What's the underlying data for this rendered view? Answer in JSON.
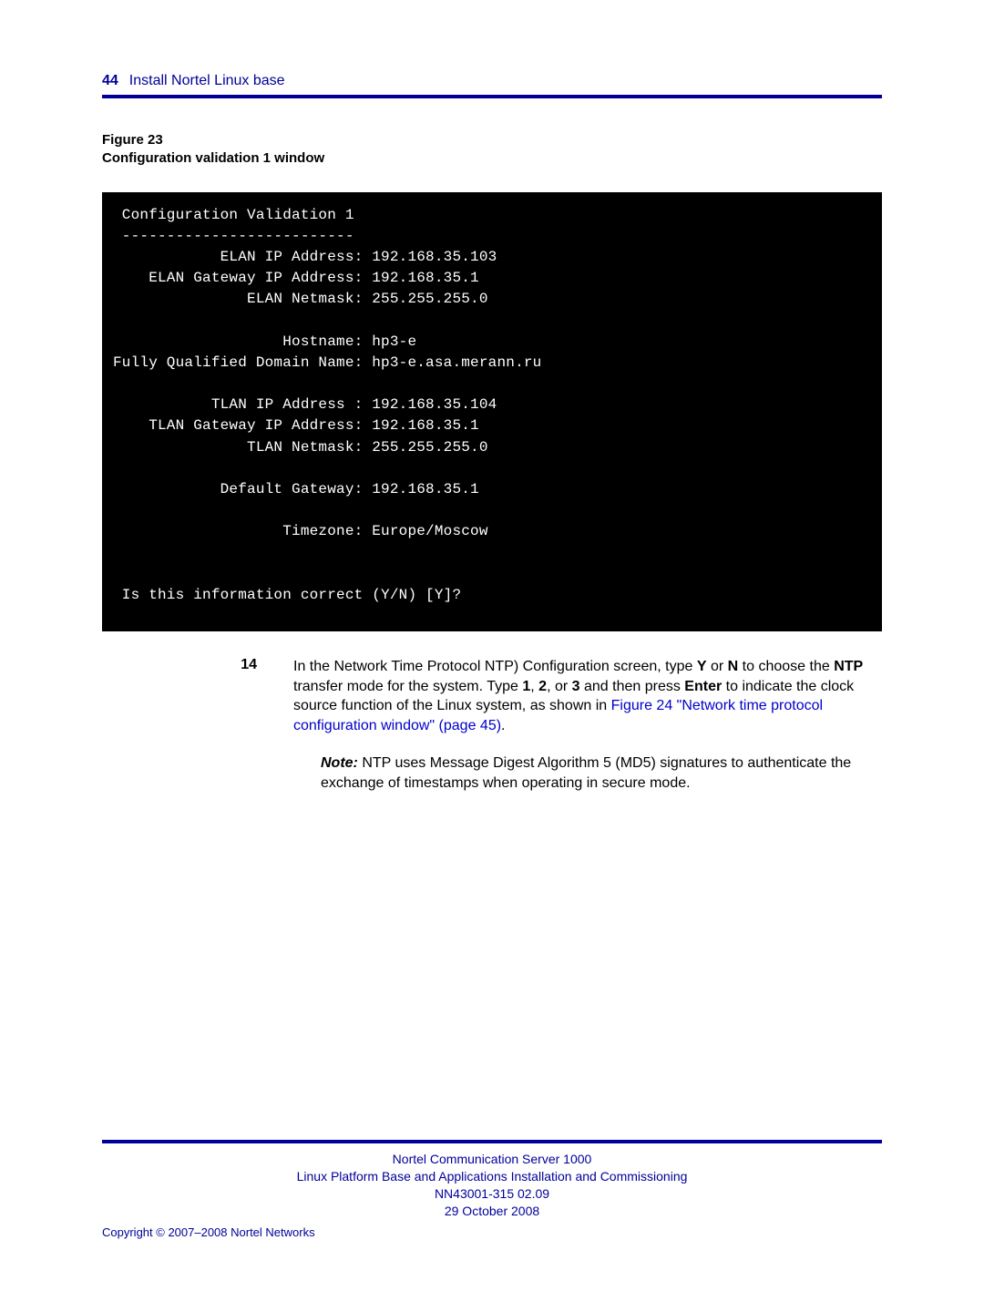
{
  "header": {
    "page_number": "44",
    "section_title": "Install Nortel Linux base"
  },
  "figure": {
    "label_line1": "Figure 23",
    "label_line2": "Configuration validation 1 window"
  },
  "terminal": {
    "title": "Configuration Validation 1",
    "divider": "--------------------------",
    "rows": [
      {
        "label": "ELAN IP Address",
        "value": "192.168.35.103"
      },
      {
        "label": "ELAN Gateway IP Address",
        "value": "192.168.35.1"
      },
      {
        "label": "ELAN Netmask",
        "value": "255.255.255.0"
      },
      {
        "label": "",
        "value": ""
      },
      {
        "label": "Hostname",
        "value": "hp3-e"
      },
      {
        "label": "Fully Qualified Domain Name",
        "value": "hp3-e.asa.merann.ru"
      },
      {
        "label": "",
        "value": ""
      },
      {
        "label": "TLAN IP Address ",
        "value": "192.168.35.104"
      },
      {
        "label": "TLAN Gateway IP Address",
        "value": "192.168.35.1"
      },
      {
        "label": "TLAN Netmask",
        "value": "255.255.255.0"
      },
      {
        "label": "",
        "value": ""
      },
      {
        "label": "Default Gateway",
        "value": "192.168.35.1"
      },
      {
        "label": "",
        "value": ""
      },
      {
        "label": "Timezone",
        "value": "Europe/Moscow"
      }
    ],
    "prompt": "Is this information correct (Y/N) [Y]?"
  },
  "step": {
    "number": "14",
    "text_pre": "In the Network Time Protocol NTP) Configuration screen, type ",
    "bold1": "Y",
    "mid1": " or ",
    "bold2": "N",
    "mid2": " to choose the ",
    "bold3": "NTP",
    "mid3": " transfer mode for the system. Type ",
    "bold4": "1",
    "comma1": ", ",
    "bold5": "2",
    "comma2": ", or ",
    "bold6": "3",
    "mid4": " and then press ",
    "bold7": "Enter",
    "mid5": " to indicate the clock source function of the Linux system, as shown in ",
    "link": "Figure 24 \"Network time protocol configuration window\" (page 45)",
    "tail": "."
  },
  "note": {
    "label": "Note:",
    "text": " NTP uses Message Digest Algorithm 5 (MD5) signatures to authenticate the exchange of timestamps when operating in secure mode."
  },
  "footer": {
    "line1": "Nortel Communication Server 1000",
    "line2": "Linux Platform Base and Applications Installation and Commissioning",
    "line3": "NN43001-315   02.09",
    "line4": "29 October 2008",
    "copyright": "Copyright © 2007–2008 Nortel Networks"
  }
}
